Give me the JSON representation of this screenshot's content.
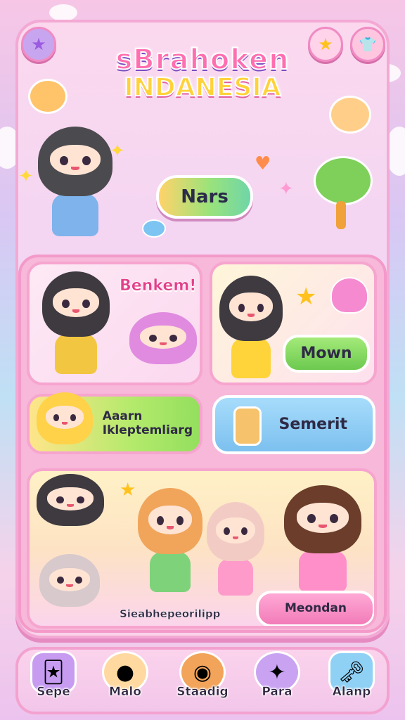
{
  "title": {
    "line1": "sBrahoken",
    "line2": "INDANESIA"
  },
  "top_buttons": {
    "left_icon": "star-icon",
    "right_star_icon": "star-icon",
    "right_shirt_icon": "shirt-icon"
  },
  "main_button": {
    "label": "Nars"
  },
  "cards": {
    "card1": {
      "caption": "Benkem!"
    },
    "card2": {
      "button_label": "Mown"
    },
    "card3": {
      "line1": "Aaarn",
      "line2": "Ikleptemliarg"
    },
    "card4": {
      "label": "Semerit"
    },
    "card5": {
      "label_left": "Sieabhepeorilipp",
      "label_right": "Meondan"
    }
  },
  "dock": [
    {
      "label": "Sepe",
      "icon": "card-deck-icon"
    },
    {
      "label": "Malo",
      "icon": "blob-pet-icon"
    },
    {
      "label": "Staadig",
      "icon": "cat-pet-icon"
    },
    {
      "label": "Para",
      "icon": "wand-icon"
    },
    {
      "label": "Alanp",
      "icon": "key-icon"
    }
  ],
  "colors": {
    "accent_pink": "#f39ac9",
    "accent_green": "#8fe06a",
    "accent_blue": "#8fd0f5",
    "accent_yellow": "#ffd23a"
  }
}
